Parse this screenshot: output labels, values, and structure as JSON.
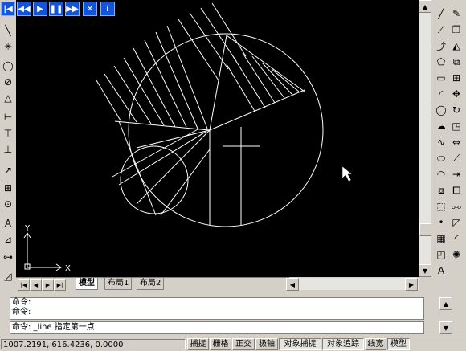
{
  "player": {
    "buttons": [
      {
        "name": "rewind-start-icon",
        "glyph": "|◀"
      },
      {
        "name": "rewind-icon",
        "glyph": "◀◀"
      },
      {
        "name": "play-icon",
        "glyph": "▶"
      },
      {
        "name": "pause-icon",
        "glyph": "❚❚"
      },
      {
        "name": "fast-forward-icon",
        "glyph": "▶▶"
      },
      {
        "name": "close-icon",
        "glyph": "✕"
      },
      {
        "name": "info-icon",
        "glyph": "i"
      }
    ]
  },
  "ucs": {
    "x_label": "X",
    "y_label": "Y"
  },
  "tabs": {
    "model": "模型",
    "layout1": "布局1",
    "layout2": "布局2"
  },
  "command": {
    "history_1": "命令:",
    "history_2": "命令:",
    "current": "命令: _line 指定第一点:"
  },
  "status": {
    "coords": "1007.2191, 616.4236, 0.0000",
    "toggles": [
      {
        "label": "捕捉",
        "on": false
      },
      {
        "label": "栅格",
        "on": false
      },
      {
        "label": "正交",
        "on": false
      },
      {
        "label": "极轴",
        "on": false
      },
      {
        "label": "对象捕捉",
        "on": true
      },
      {
        "label": "对象追踪",
        "on": true
      },
      {
        "label": "线宽",
        "on": false
      },
      {
        "label": "模型",
        "on": true
      }
    ]
  },
  "colors": {
    "canvas": "#000000",
    "drawing": "#ffffff",
    "ui": "#d4d0c8",
    "player": "#1155dd"
  }
}
